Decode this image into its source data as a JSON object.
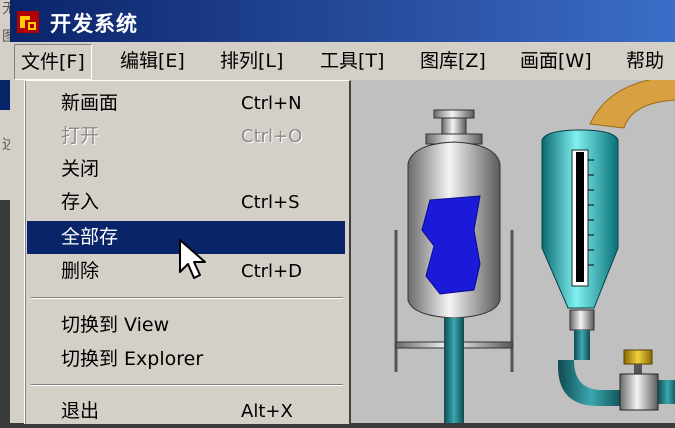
{
  "background": {
    "fragment_1": "无",
    "fragment_2": "图",
    "fragment_3": "述"
  },
  "window": {
    "title": "开发系统",
    "icon": "app-logo-icon"
  },
  "menu_bar": [
    {
      "label": "文件[F]",
      "active": true
    },
    {
      "label": "编辑[E]"
    },
    {
      "label": "排列[L]"
    },
    {
      "label": "工具[T]"
    },
    {
      "label": "图库[Z]"
    },
    {
      "label": "画面[W]"
    },
    {
      "label": "帮助"
    }
  ],
  "file_menu": [
    {
      "label": "新画面",
      "shortcut": "Ctrl+N"
    },
    {
      "label": "打开",
      "shortcut": "Ctrl+O",
      "disabled": true
    },
    {
      "label": "关闭",
      "shortcut": ""
    },
    {
      "label": "存入",
      "shortcut": "Ctrl+S"
    },
    {
      "label": "全部存",
      "shortcut": "",
      "selected": true
    },
    {
      "label": "删除",
      "shortcut": "Ctrl+D"
    },
    {
      "label": "切换到 View",
      "shortcut": ""
    },
    {
      "label": "切换到 Explorer",
      "shortcut": ""
    },
    {
      "label": "退出",
      "shortcut": "Alt+X"
    }
  ],
  "colors": {
    "title_bar": "#0a246a",
    "selection": "#0a246a",
    "menu_bg": "#d4d0c8",
    "tank_liquid": "#1a1ad8",
    "pipe": "#1e7a80",
    "cyan_vessel": "#20c0c8",
    "valve_top": "#c8a000"
  },
  "cursor": "arrow-cursor-icon"
}
